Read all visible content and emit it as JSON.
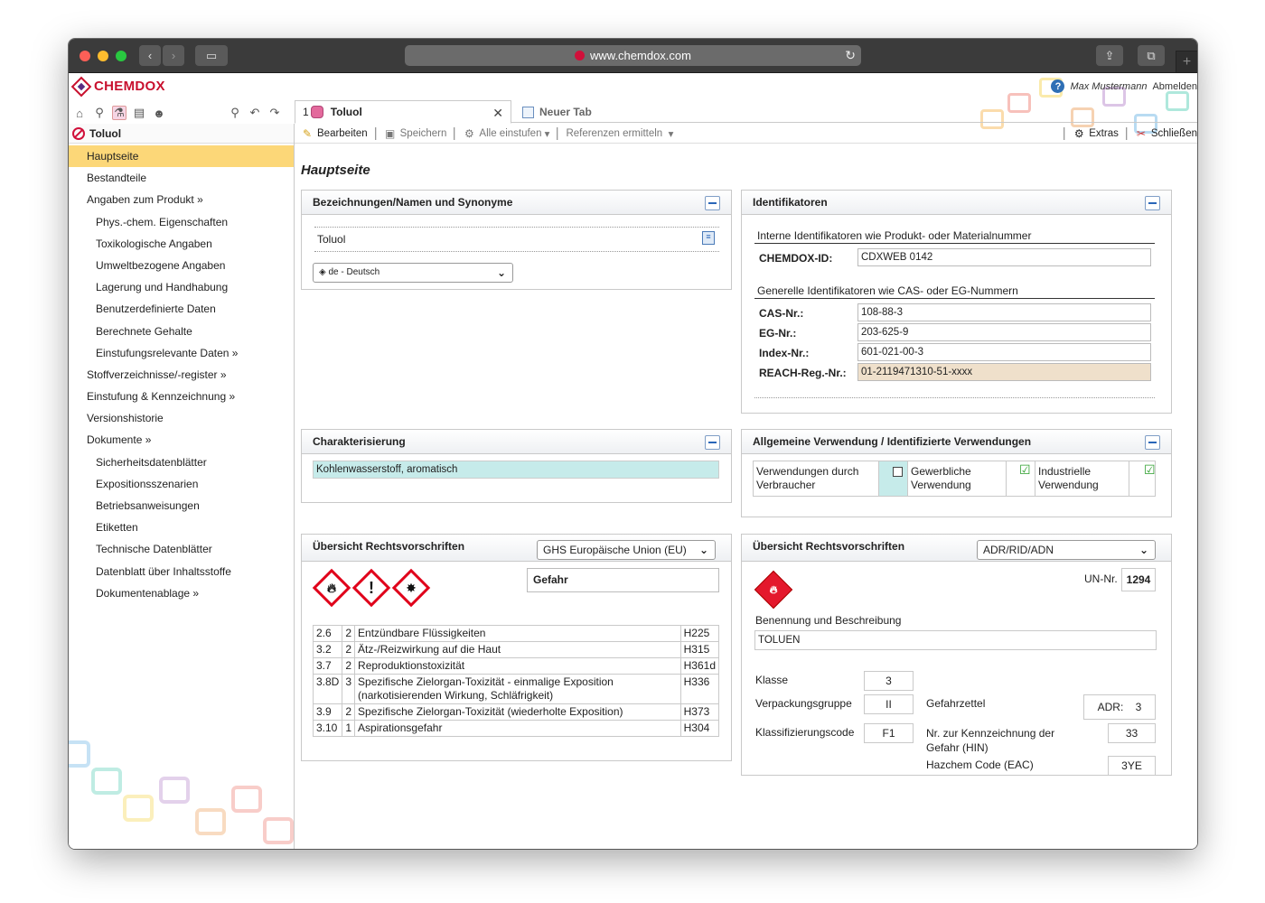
{
  "browser": {
    "url": "www.chemdox.com"
  },
  "app": {
    "logo": "CHEMDOX",
    "user": "Max Mustermann",
    "logout": "Abmelden"
  },
  "sidebar": {
    "title": "Toluol",
    "items": [
      {
        "label": "Hauptseite",
        "level": 0,
        "active": true
      },
      {
        "label": "Bestandteile",
        "level": 0
      },
      {
        "label": "Angaben zum Produkt »",
        "level": 0
      },
      {
        "label": "Phys.-chem. Eigenschaften",
        "level": 1
      },
      {
        "label": "Toxikologische Angaben",
        "level": 1
      },
      {
        "label": "Umweltbezogene Angaben",
        "level": 1
      },
      {
        "label": "Lagerung und Handhabung",
        "level": 1
      },
      {
        "label": "Benutzerdefinierte Daten",
        "level": 1
      },
      {
        "label": "Berechnete Gehalte",
        "level": 1
      },
      {
        "label": "Einstufungsrelevante Daten »",
        "level": 1
      },
      {
        "label": "Stoffverzeichnisse/-register »",
        "level": 0
      },
      {
        "label": "Einstufung & Kennzeichnung »",
        "level": 0
      },
      {
        "label": "Versionshistorie",
        "level": 0
      },
      {
        "label": "Dokumente »",
        "level": 0
      },
      {
        "label": "Sicherheitsdatenblätter",
        "level": 1
      },
      {
        "label": "Expositionsszenarien",
        "level": 1
      },
      {
        "label": "Betriebsanweisungen",
        "level": 1
      },
      {
        "label": "Etiketten",
        "level": 1
      },
      {
        "label": "Technische Datenblätter",
        "level": 1
      },
      {
        "label": "Datenblatt über Inhaltsstoffe",
        "level": 1
      },
      {
        "label": "Dokumentenablage »",
        "level": 1
      }
    ]
  },
  "tabs": {
    "active": {
      "num": "1",
      "label": "Toluol"
    },
    "new": "Neuer Tab"
  },
  "toolbar": {
    "edit": "Bearbeiten",
    "save": "Speichern",
    "collapse_all": "Alle einstufen",
    "references": "Referenzen ermitteln",
    "extras": "Extras",
    "close": "Schließen"
  },
  "page_title": "Hauptseite",
  "names": {
    "title": "Bezeichnungen/Namen und Synonyme",
    "name": "Toluol",
    "language": "de - Deutsch"
  },
  "identifiers": {
    "title": "Identifikatoren",
    "internal_heading": "Interne Identifikatoren wie Produkt- oder Materialnummer",
    "chemdox_label": "CHEMDOX-ID:",
    "chemdox_value": "CDXWEB 0142",
    "general_heading": "Generelle Identifikatoren wie CAS- oder EG-Nummern",
    "cas_label": "CAS-Nr.:",
    "cas_value": "108-88-3",
    "eg_label": "EG-Nr.:",
    "eg_value": "203-625-9",
    "index_label": "Index-Nr.:",
    "index_value": "601-021-00-3",
    "reach_label": "REACH-Reg.-Nr.:",
    "reach_value": "01-2119471310-51-xxxx"
  },
  "characterization": {
    "title": "Charakterisierung",
    "value": "Kohlenwasserstoff, aromatisch"
  },
  "usage": {
    "title": "Allgemeine Verwendung / Identifizierte Verwendungen",
    "consumer": "Verwendungen durch Verbraucher",
    "professional": "Gewerbliche Verwendung",
    "industrial": "Industrielle Verwendung",
    "consumer_checked": false,
    "professional_checked": true,
    "industrial_checked": true
  },
  "ghs": {
    "title": "Übersicht Rechtsvorschriften",
    "regulation": "GHS Europäische Union (EU)",
    "signal_word": "Gefahr",
    "pictograms": [
      "flame-icon",
      "exclamation-icon",
      "health-hazard-icon"
    ],
    "rows": [
      {
        "code": "2.6",
        "cat": "2",
        "text": "Entzündbare Flüssigkeiten",
        "h": "H225"
      },
      {
        "code": "3.2",
        "cat": "2",
        "text": "Ätz-/Reizwirkung auf die Haut",
        "h": "H315"
      },
      {
        "code": "3.7",
        "cat": "2",
        "text": "Reproduktionstoxizität",
        "h": "H361d"
      },
      {
        "code": "3.8D",
        "cat": "3",
        "text": "Spezifische Zielorgan-Toxizität - einmalige Exposition (narkotisierenden Wirkung, Schläfrigkeit)",
        "h": "H336"
      },
      {
        "code": "3.9",
        "cat": "2",
        "text": "Spezifische Zielorgan-Toxizität (wiederholte Exposition)",
        "h": "H373"
      },
      {
        "code": "3.10",
        "cat": "1",
        "text": "Aspirationsgefahr",
        "h": "H304"
      }
    ]
  },
  "transport": {
    "title": "Übersicht Rechtsvorschriften",
    "regulation": "ADR/RID/ADN",
    "un_label": "UN-Nr.",
    "un_value": "1294",
    "name_label": "Benennung und Beschreibung",
    "name_value": "TOLUEN",
    "class_label": "Klasse",
    "class_value": "3",
    "packing_label": "Verpackungsgruppe",
    "packing_value": "II",
    "classcode_label": "Klassifizierungscode",
    "classcode_value": "F1",
    "label_label": "Gefahrzettel",
    "label_prefix": "ADR:",
    "label_value": "3",
    "hin_label": "Nr. zur Kennzeichnung der Gefahr (HIN)",
    "hin_value": "33",
    "eac_label": "Hazchem Code (EAC)",
    "eac_value": "3YE"
  }
}
